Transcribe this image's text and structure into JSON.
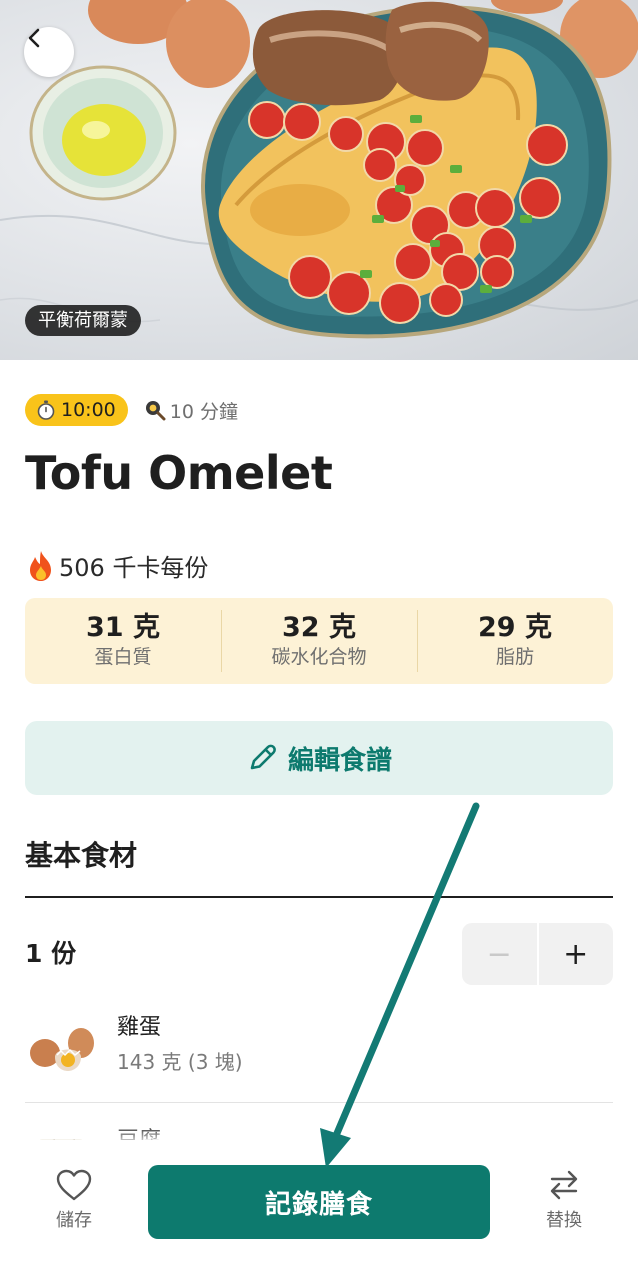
{
  "hero": {
    "tag": "平衡荷爾蒙"
  },
  "meta": {
    "timer": "10:00",
    "prep_time": "10 分鐘"
  },
  "recipe": {
    "title": "Tofu Omelet",
    "calories": "506 千卡每份"
  },
  "macros": [
    {
      "value": "31 克",
      "label": "蛋白質"
    },
    {
      "value": "32 克",
      "label": "碳水化合物"
    },
    {
      "value": "29 克",
      "label": "脂肪"
    }
  ],
  "actions": {
    "edit_recipe": "編輯食譜"
  },
  "ingredients": {
    "section_title": "基本食材",
    "servings": "1 份",
    "stepper": {
      "minus": "−",
      "plus": "+"
    },
    "items": [
      {
        "name": "雞蛋",
        "amount": "143 克 (3 塊)"
      },
      {
        "name": "豆腐",
        "amount": ""
      }
    ]
  },
  "bottom_bar": {
    "save_label": "儲存",
    "log_label": "記錄膳食",
    "swap_label": "替換"
  },
  "colors": {
    "accent": "#0d7a6e",
    "badge": "#f9c31a",
    "macro_bg": "#fdf2d6",
    "edit_bg": "#e3f2ef"
  }
}
